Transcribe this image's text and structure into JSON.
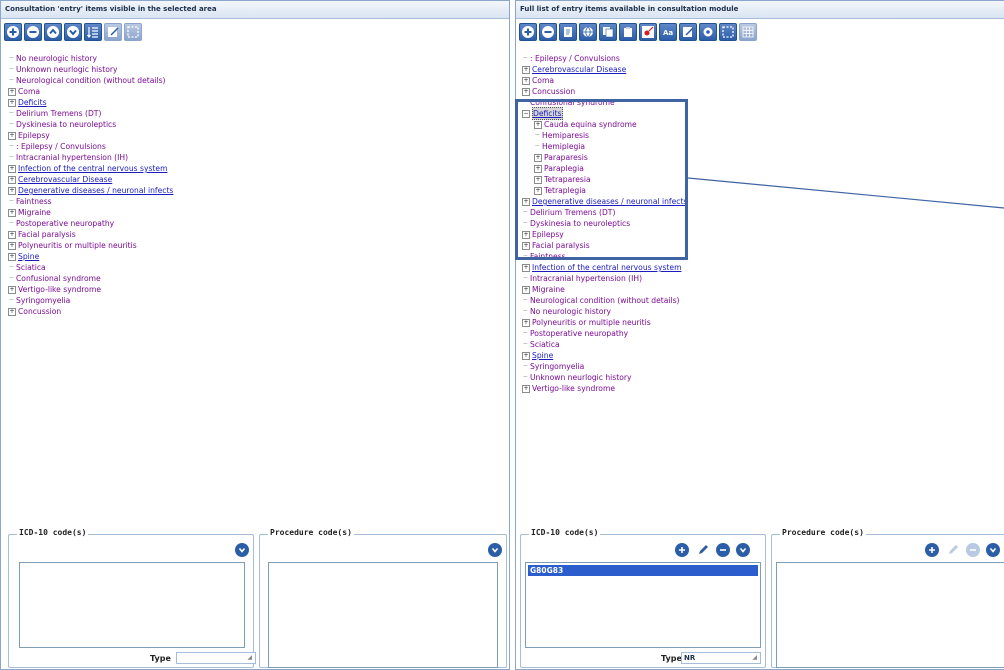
{
  "left_panel": {
    "header": "Consultation 'entry' items visible in the selected area",
    "toolbar": [
      {
        "icon": "add-icon",
        "enabled": true
      },
      {
        "icon": "remove-icon",
        "enabled": true
      },
      {
        "icon": "move-up-icon",
        "enabled": true
      },
      {
        "icon": "move-down-icon",
        "enabled": true
      },
      {
        "icon": "sort-icon",
        "enabled": true
      },
      {
        "icon": "edit-icon",
        "enabled": false
      },
      {
        "icon": "select-area-icon",
        "enabled": false
      }
    ],
    "tree": [
      {
        "label": "No neurologic history",
        "expandable": false,
        "link": false
      },
      {
        "label": "Unknown neurlogic history",
        "expandable": false,
        "link": false
      },
      {
        "label": "Neurological condition (without details)",
        "expandable": false,
        "link": false
      },
      {
        "label": "Coma",
        "expandable": true,
        "link": false
      },
      {
        "label": "Deficits",
        "expandable": true,
        "link": true
      },
      {
        "label": "Delirium Tremens (DT)",
        "expandable": false,
        "link": false
      },
      {
        "label": "Dyskinesia to neuroleptics",
        "expandable": false,
        "link": false
      },
      {
        "label": "Epilepsy",
        "expandable": true,
        "link": false
      },
      {
        "label": ": Epilepsy / Convulsions",
        "expandable": false,
        "link": false
      },
      {
        "label": "Intracranial hypertension (IH)",
        "expandable": false,
        "link": false
      },
      {
        "label": "Infection of the central nervous system",
        "expandable": true,
        "link": true
      },
      {
        "label": "Cerebrovascular Disease",
        "expandable": true,
        "link": true
      },
      {
        "label": "Degenerative diseases / neuronal infects",
        "expandable": true,
        "link": true
      },
      {
        "label": "Faintness",
        "expandable": false,
        "link": false
      },
      {
        "label": "Migraine",
        "expandable": true,
        "link": false
      },
      {
        "label": "Postoperative neuropathy",
        "expandable": false,
        "link": false
      },
      {
        "label": "Facial paralysis",
        "expandable": true,
        "link": false
      },
      {
        "label": "Polyneuritis or multiple neuritis",
        "expandable": true,
        "link": false
      },
      {
        "label": "Spine",
        "expandable": true,
        "link": true
      },
      {
        "label": "Sciatica",
        "expandable": false,
        "link": false
      },
      {
        "label": "Confusional syndrome",
        "expandable": false,
        "link": false
      },
      {
        "label": "Vertigo-like syndrome",
        "expandable": true,
        "link": false
      },
      {
        "label": "Syringomyelia",
        "expandable": false,
        "link": false
      },
      {
        "label": "Concussion",
        "expandable": true,
        "link": false
      }
    ],
    "icd_title": "ICD-10 code(s)",
    "procedure_title": "Procedure code(s)",
    "icd_items": [],
    "type_label": "Type",
    "type_value": ""
  },
  "right_panel": {
    "header": "Full list of entry items available in consultation module",
    "toolbar": [
      {
        "icon": "add-icon",
        "enabled": true
      },
      {
        "icon": "remove-icon",
        "enabled": true
      },
      {
        "icon": "document-icon",
        "enabled": true
      },
      {
        "icon": "globe-icon",
        "enabled": true
      },
      {
        "icon": "copy-icon",
        "enabled": true
      },
      {
        "icon": "paste-icon",
        "enabled": true
      },
      {
        "icon": "record-icon",
        "enabled": true
      },
      {
        "icon": "text-size-icon",
        "enabled": true
      },
      {
        "icon": "edit-icon",
        "enabled": true
      },
      {
        "icon": "settings-icon",
        "enabled": true
      },
      {
        "icon": "select-area-icon",
        "enabled": true
      },
      {
        "icon": "grid-icon",
        "enabled": false
      }
    ],
    "tree": [
      {
        "label": ": Epilepsy / Convulsions",
        "expandable": false,
        "link": false,
        "level": 0
      },
      {
        "label": "Cerebrovascular Disease",
        "expandable": true,
        "link": true,
        "level": 0
      },
      {
        "label": "Coma",
        "expandable": true,
        "link": false,
        "level": 0
      },
      {
        "label": "Concussion",
        "expandable": true,
        "link": false,
        "level": 0
      },
      {
        "label": "Confusional syndrome",
        "expandable": false,
        "link": false,
        "level": 0
      },
      {
        "label": "Deficits",
        "expandable": true,
        "expanded": true,
        "link": true,
        "selected": true,
        "level": 0
      },
      {
        "label": "Cauda equina syndrome",
        "expandable": true,
        "link": false,
        "level": 1
      },
      {
        "label": "Hemiparesis",
        "expandable": false,
        "link": false,
        "level": 1
      },
      {
        "label": "Hemiplegia",
        "expandable": false,
        "link": false,
        "level": 1
      },
      {
        "label": "Paraparesis",
        "expandable": true,
        "link": false,
        "level": 1
      },
      {
        "label": "Paraplegia",
        "expandable": true,
        "link": false,
        "level": 1
      },
      {
        "label": "Tetraparesia",
        "expandable": true,
        "link": false,
        "level": 1
      },
      {
        "label": "Tetraplegia",
        "expandable": true,
        "link": false,
        "level": 1
      },
      {
        "label": "Degenerative diseases / neuronal infects",
        "expandable": true,
        "link": true,
        "level": 0
      },
      {
        "label": "Delirium Tremens (DT)",
        "expandable": false,
        "link": false,
        "level": 0
      },
      {
        "label": "Dyskinesia to neuroleptics",
        "expandable": false,
        "link": false,
        "level": 0
      },
      {
        "label": "Epilepsy",
        "expandable": true,
        "link": false,
        "level": 0
      },
      {
        "label": "Facial paralysis",
        "expandable": true,
        "link": false,
        "level": 0
      },
      {
        "label": "Faintness",
        "expandable": false,
        "link": false,
        "level": 0
      },
      {
        "label": "Infection of the central nervous system",
        "expandable": true,
        "link": true,
        "level": 0
      },
      {
        "label": "Intracranial hypertension (IH)",
        "expandable": false,
        "link": false,
        "level": 0
      },
      {
        "label": "Migraine",
        "expandable": true,
        "link": false,
        "level": 0
      },
      {
        "label": "Neurological condition (without details)",
        "expandable": false,
        "link": false,
        "level": 0
      },
      {
        "label": "No neurologic history",
        "expandable": false,
        "link": false,
        "level": 0
      },
      {
        "label": "Polyneuritis or multiple neuritis",
        "expandable": true,
        "link": false,
        "level": 0
      },
      {
        "label": "Postoperative neuropathy",
        "expandable": false,
        "link": false,
        "level": 0
      },
      {
        "label": "Sciatica",
        "expandable": false,
        "link": false,
        "level": 0
      },
      {
        "label": "Spine",
        "expandable": true,
        "link": true,
        "level": 0
      },
      {
        "label": "Syringomyelia",
        "expandable": false,
        "link": false,
        "level": 0
      },
      {
        "label": "Unknown neurlogic history",
        "expandable": false,
        "link": false,
        "level": 0
      },
      {
        "label": "Vertigo-like syndrome",
        "expandable": true,
        "link": false,
        "level": 0
      }
    ],
    "icd_title": "ICD-10 code(s)",
    "procedure_title": "Procedure code(s)",
    "icd_items": [
      "G80G83"
    ],
    "type_label": "Type",
    "type_value": "NR"
  },
  "colors": {
    "item_text": "#7a0b92",
    "link_text": "#1b1bbe",
    "accent": "#2c5ea7",
    "selection": "#2b5dcc",
    "highlight_box": "#3f63a3"
  }
}
